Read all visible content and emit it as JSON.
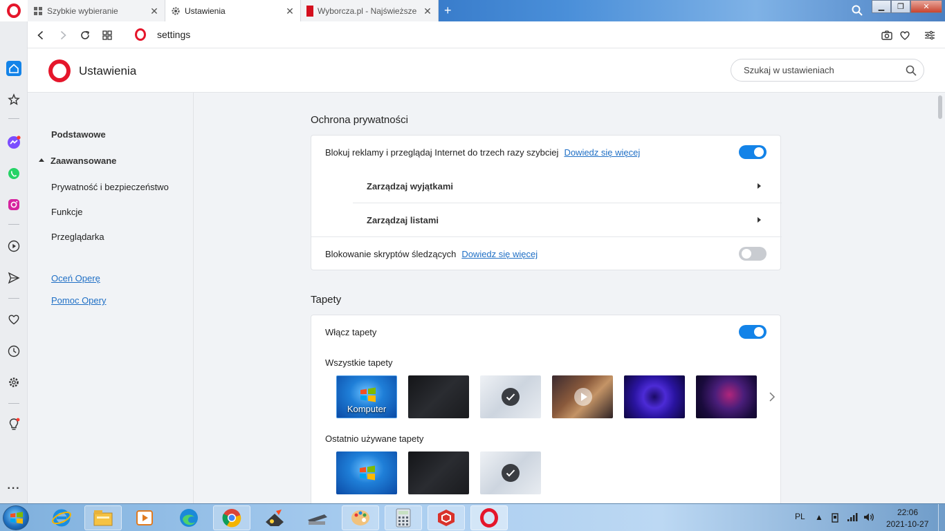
{
  "tabs": [
    {
      "title": "Szybkie wybieranie",
      "icon": "speed-dial-icon",
      "active": false
    },
    {
      "title": "Ustawienia",
      "icon": "gear-icon",
      "active": true
    },
    {
      "title": "Wyborcza.pl - Najświeższe",
      "icon": "wyborcza-icon",
      "active": false
    }
  ],
  "address": {
    "url": "settings"
  },
  "settings": {
    "title": "Ustawienia",
    "search_placeholder": "Szukaj w ustawieniach"
  },
  "leftnav": {
    "basic": "Podstawowe",
    "advanced": "Zaawansowane",
    "items": [
      "Prywatność i bezpieczeństwo",
      "Funkcje",
      "Przeglądarka"
    ],
    "links": [
      "Oceń Operę",
      "Pomoc Opery"
    ]
  },
  "privacy": {
    "title": "Ochrona prywatności",
    "adblock_label": "Blokuj reklamy i przeglądaj Internet do trzech razy szybciej",
    "adblock_more": "Dowiedz się więcej",
    "adblock_on": true,
    "exceptions": "Zarządzaj wyjątkami",
    "lists": "Zarządzaj listami",
    "tracker_label": "Blokowanie skryptów śledzących",
    "tracker_more": "Dowiedz się więcej",
    "tracker_on": false
  },
  "wallpapers": {
    "title": "Tapety",
    "enable_label": "Włącz tapety",
    "enabled": true,
    "all_label": "Wszystkie tapety",
    "all": [
      {
        "name": "windows-7-wallpaper",
        "caption": "Komputer"
      },
      {
        "name": "dark-waves-wallpaper"
      },
      {
        "name": "light-waves-wallpaper",
        "selected": true
      },
      {
        "name": "game-scene-wallpaper",
        "video": true
      },
      {
        "name": "purple-vortex-wallpaper"
      },
      {
        "name": "neon-figure-wallpaper"
      }
    ],
    "recent_label": "Ostatnio używane tapety",
    "recent": [
      {
        "name": "windows-7-wallpaper"
      },
      {
        "name": "dark-waves-wallpaper"
      },
      {
        "name": "light-waves-wallpaper",
        "selected": true
      }
    ]
  },
  "taskbar": {
    "language": "PL",
    "time": "22:06",
    "date": "2021-10-27"
  },
  "colors": {
    "opera_red": "#e5162b",
    "accent_blue": "#1383e8",
    "link_blue": "#1f6fc5"
  }
}
